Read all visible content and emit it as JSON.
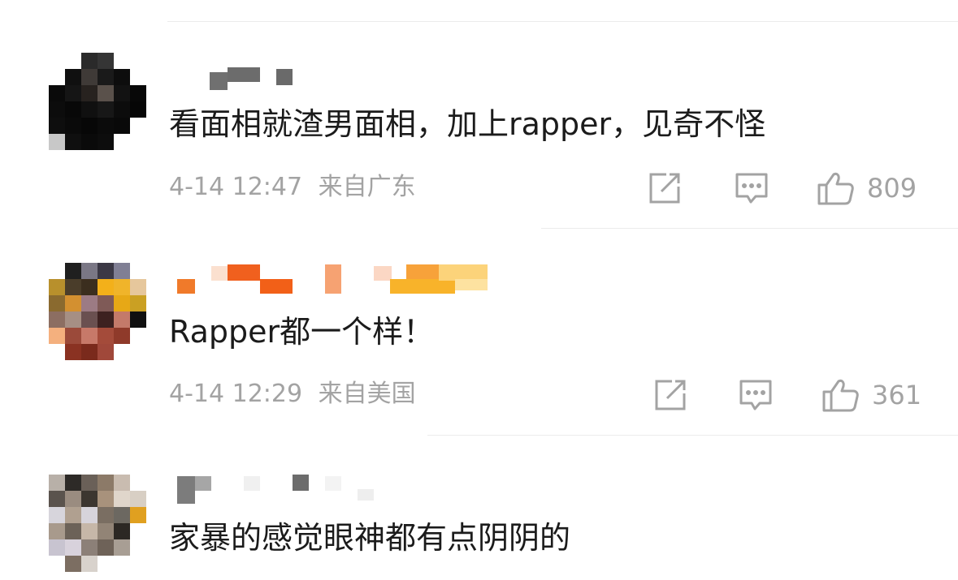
{
  "comments": [
    {
      "text": "看面相就渣男面相，加上rapper，见奇不怪",
      "time": "4-14 12:47",
      "location": "来自广东",
      "likes": "809",
      "avatar_colors": [
        "#ffffff",
        "#ffffff",
        "#2a2a2a",
        "#353535",
        "#ffffff",
        "#ffffff",
        "#ffffff",
        "#101010",
        "#3f3a37",
        "#1a1a1a",
        "#0d0d0d",
        "#ffffff",
        "#0a0a0a",
        "#151515",
        "#27221f",
        "#5a514b",
        "#121212",
        "#080808",
        "#0c0c0c",
        "#080808",
        "#101010",
        "#171717",
        "#0c0c0c",
        "#060606",
        "#0e0e0e",
        "#0a0a0a",
        "#070707",
        "#0b0b0b",
        "#090909",
        "#ffffff",
        "#c8c8c8",
        "#0f0f0f",
        "#0a0a0a",
        "#0d0d0d",
        "#ffffff",
        "#ffffff"
      ]
    },
    {
      "text": "Rapper都一个样！",
      "time": "4-14 12:29",
      "location": "来自美国",
      "likes": "361",
      "avatar_colors": [
        "#ffffff",
        "#1f1f1f",
        "#7a7785",
        "#3b3845",
        "#807f94",
        "#ffffff",
        "#b8902c",
        "#4a3d2a",
        "#3b2e1e",
        "#f3b01a",
        "#f0b42a",
        "#e6c79c",
        "#8a6a2f",
        "#d39030",
        "#9c7b84",
        "#7f5a57",
        "#e7a816",
        "#caa023",
        "#8c6e62",
        "#a68f84",
        "#6a5050",
        "#3d2120",
        "#c47a6a",
        "#101010",
        "#f4b07e",
        "#9b4a3a",
        "#c77969",
        "#a44b3a",
        "#8f3a2a",
        "#ffffff",
        "#ffffff",
        "#8a3222",
        "#7a2a1c",
        "#a0483a",
        "#ffffff",
        "#ffffff"
      ]
    },
    {
      "text": "家暴的感觉眼神都有点阴阴的",
      "avatar_colors": [
        "#b8b0a8",
        "#2d2a27",
        "#6a6058",
        "#8c7a68",
        "#c9bcb0",
        "#ffffff",
        "#5a534d",
        "#9a8c80",
        "#3c3630",
        "#a8927c",
        "#e0d6cb",
        "#d8cfc4",
        "#d7d5dc",
        "#b0a090",
        "#d7d4db",
        "#7a6e62",
        "#6c6861",
        "#e0a020",
        "#a89a8c",
        "#6c6258",
        "#c6b7a8",
        "#928476",
        "#2c2824",
        "#ffffff",
        "#c8c4d0",
        "#d8d2dc",
        "#8c8078",
        "#6e6258",
        "#a89e94",
        "#ffffff",
        "#ffffff",
        "#7c6e62",
        "#d8d2cc",
        "#ffffff",
        "#ffffff",
        "#ffffff"
      ]
    }
  ]
}
